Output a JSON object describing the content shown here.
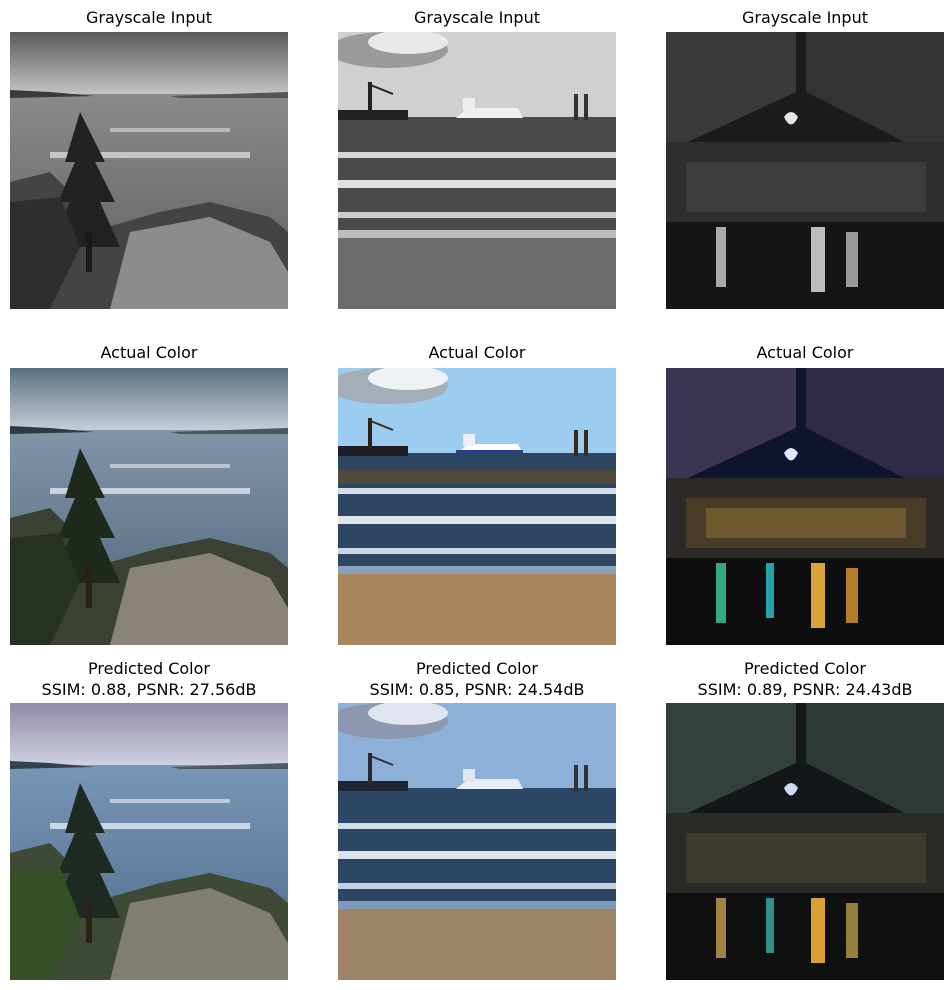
{
  "figure": {
    "rows": [
      {
        "panels": [
          {
            "title": "Grayscale Input",
            "metrics": ""
          },
          {
            "title": "Grayscale Input",
            "metrics": ""
          },
          {
            "title": "Grayscale Input",
            "metrics": ""
          }
        ]
      },
      {
        "panels": [
          {
            "title": "Actual Color",
            "metrics": ""
          },
          {
            "title": "Actual Color",
            "metrics": ""
          },
          {
            "title": "Actual Color",
            "metrics": ""
          }
        ]
      },
      {
        "panels": [
          {
            "title": "Predicted Color",
            "metrics": "SSIM: 0.88, PSNR: 27.56dB"
          },
          {
            "title": "Predicted Color",
            "metrics": "SSIM: 0.85, PSNR: 24.54dB"
          },
          {
            "title": "Predicted Color",
            "metrics": "SSIM: 0.89, PSNR: 24.43dB"
          }
        ]
      }
    ]
  }
}
